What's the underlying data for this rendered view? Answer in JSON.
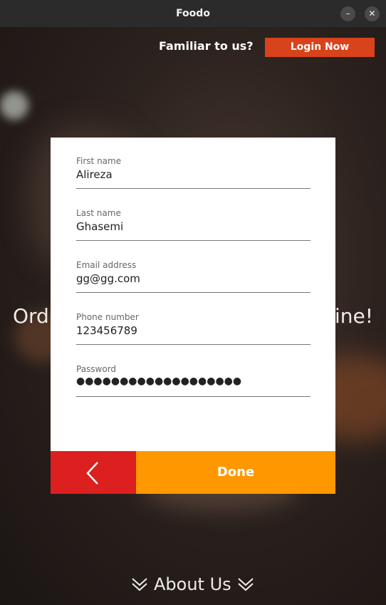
{
  "window": {
    "title": "Foodo",
    "minimize_icon": "minimize-icon",
    "close_icon": "close-icon"
  },
  "header": {
    "familiar_text": "Familiar to us?",
    "login_label": "Login Now"
  },
  "hero": {
    "left_fragment": "Ord",
    "right_fragment": "ine!"
  },
  "form": {
    "fields": [
      {
        "label": "First name",
        "value": "Alireza"
      },
      {
        "label": "Last name",
        "value": "Ghasemi"
      },
      {
        "label": "Email address",
        "value": "gg@gg.com"
      },
      {
        "label": "Phone number",
        "value": "123456789"
      },
      {
        "label": "Password",
        "value": "●●●●●●●●●●●●●●●●●●●"
      }
    ],
    "back_icon": "chevron-left-icon",
    "done_label": "Done"
  },
  "footer": {
    "about_label": "About Us",
    "about_icon": "double-chevron-down-icon"
  },
  "colors": {
    "login_button": "#d9431b",
    "back_button": "#dc1f1f",
    "done_button": "#ff9800"
  }
}
